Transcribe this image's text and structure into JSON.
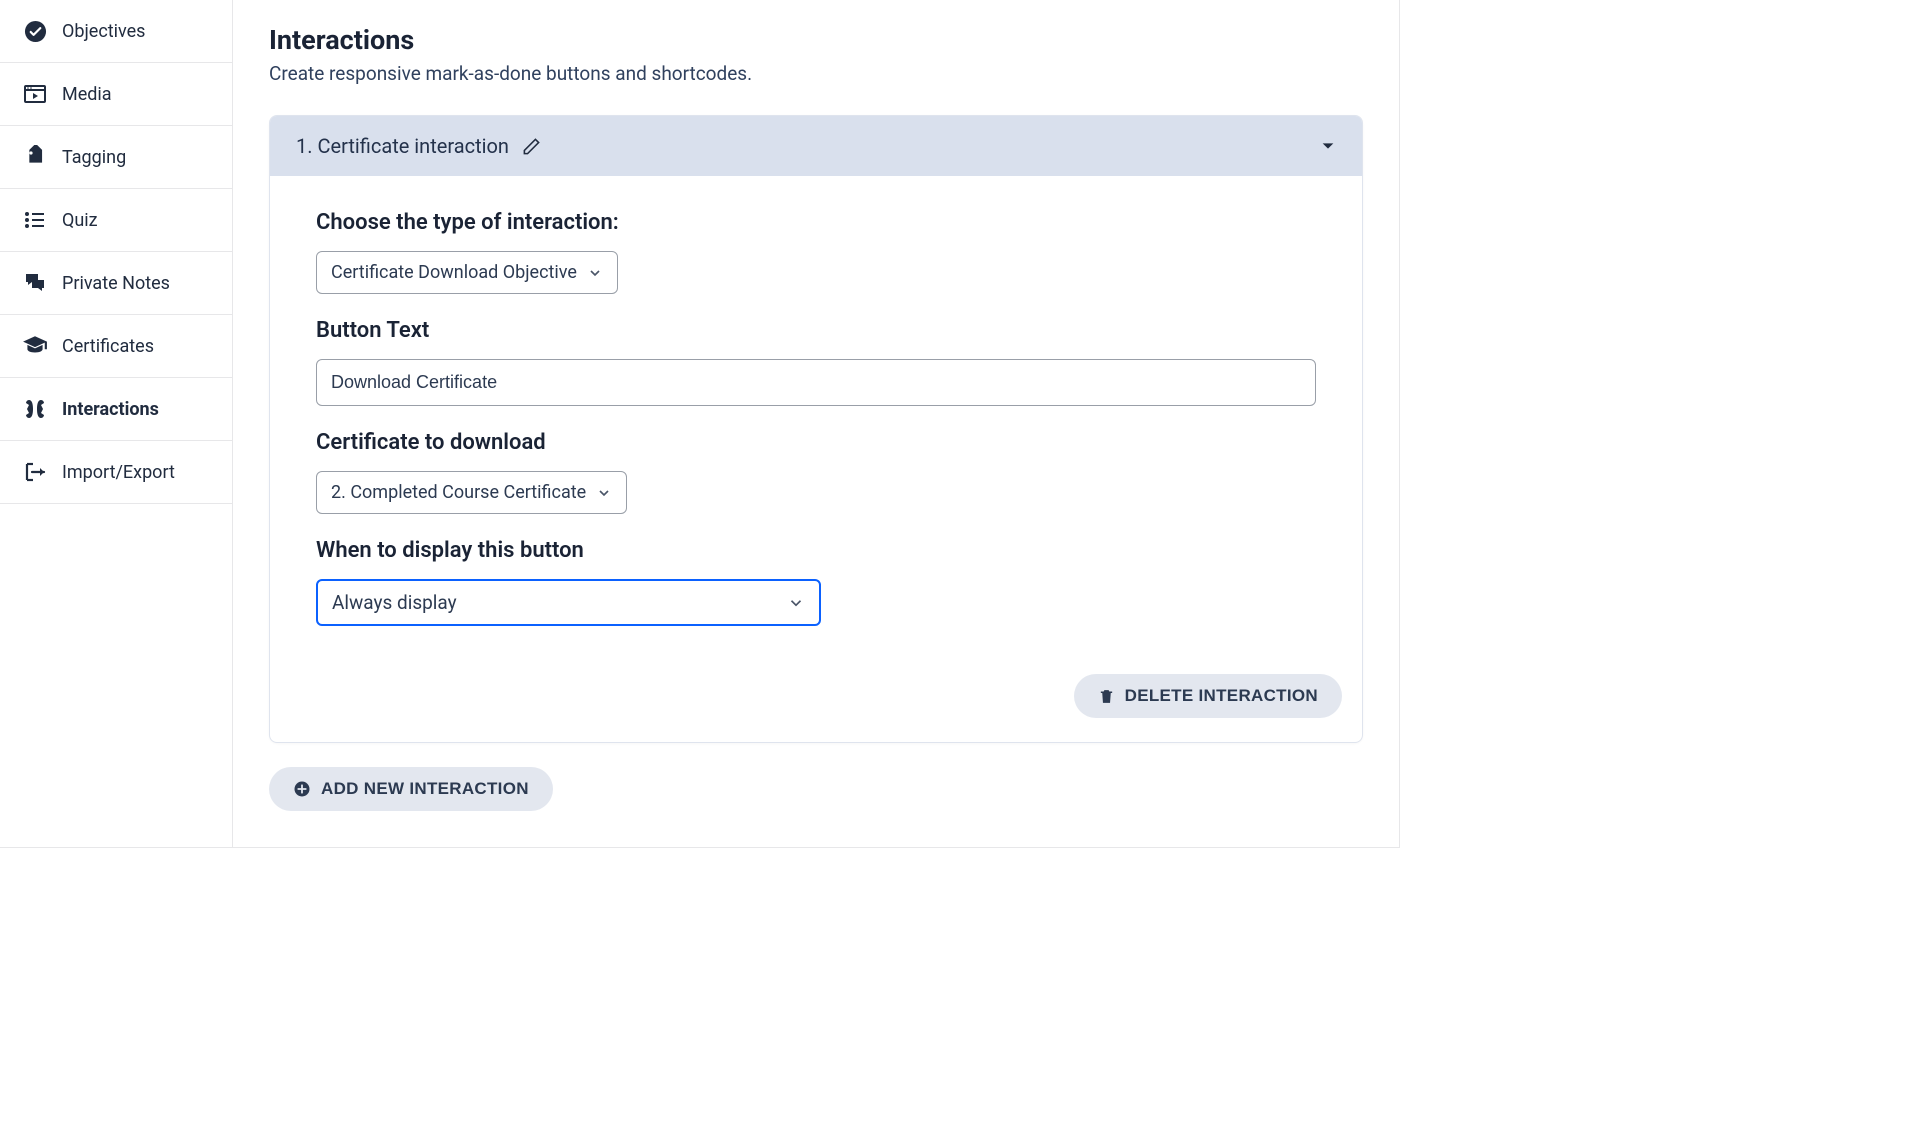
{
  "sidebar": {
    "items": [
      {
        "label": "Objectives"
      },
      {
        "label": "Media"
      },
      {
        "label": "Tagging"
      },
      {
        "label": "Quiz"
      },
      {
        "label": "Private Notes"
      },
      {
        "label": "Certificates"
      },
      {
        "label": "Interactions"
      },
      {
        "label": "Import/Export"
      }
    ]
  },
  "page": {
    "title": "Interactions",
    "subtitle": "Create responsive mark-as-done buttons and shortcodes."
  },
  "interaction": {
    "header_title": "1. Certificate interaction",
    "type_label": "Choose the type of interaction:",
    "type_value": "Certificate Download Objective",
    "button_text_label": "Button Text",
    "button_text_value": "Download Certificate",
    "cert_label": "Certificate to download",
    "cert_value": "2. Completed Course Certificate",
    "display_label": "When to display this button",
    "display_value": "Always display",
    "delete_label": "DELETE INTERACTION"
  },
  "add_button_label": "ADD NEW INTERACTION"
}
